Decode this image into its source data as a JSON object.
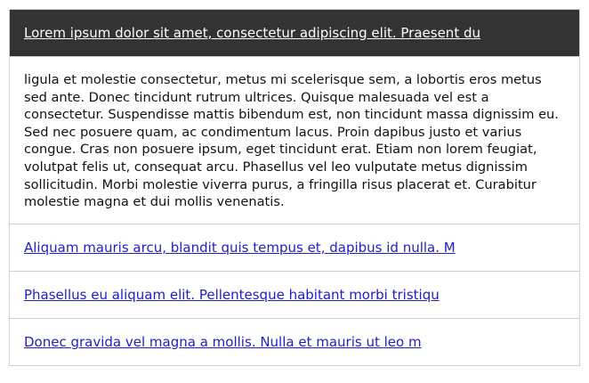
{
  "accordion": {
    "sections": [
      {
        "title": "Lorem ipsum dolor sit amet, consectetur adipiscing elit. Praesent du",
        "expanded": true,
        "body": "ligula et molestie consectetur, metus mi scelerisque sem, a lobortis eros metus sed ante. Donec tincidunt rutrum ultrices. Quisque malesuada vel est a consectetur. Suspendisse mattis bibendum est, non tincidunt massa dignissim eu. Sed nec posuere quam, ac condimentum lacus. Proin dapibus justo et varius congue. Cras non posuere ipsum, eget tincidunt erat. Etiam non lorem feugiat, volutpat felis ut, consequat arcu. Phasellus vel leo vulputate metus dignissim sollicitudin. Morbi molestie viverra purus, a fringilla risus placerat et. Curabitur molestie magna et dui mollis venenatis."
      },
      {
        "title": "Aliquam mauris arcu, blandit quis tempus et, dapibus id nulla. M",
        "expanded": false
      },
      {
        "title": "Phasellus eu aliquam elit. Pellentesque habitant morbi tristiqu",
        "expanded": false
      },
      {
        "title": "Donec gravida vel magna a mollis. Nulla et mauris ut leo m",
        "expanded": false
      }
    ]
  },
  "colors": {
    "active_header_bg": "#333333",
    "active_header_text": "#ffffff",
    "link": "#2020c8",
    "border": "#cfcfcf"
  }
}
